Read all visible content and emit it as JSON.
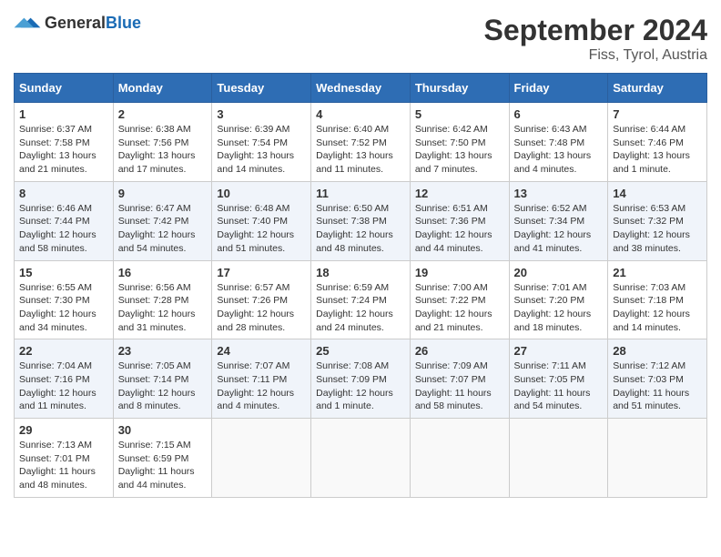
{
  "header": {
    "logo_general": "General",
    "logo_blue": "Blue",
    "month": "September 2024",
    "location": "Fiss, Tyrol, Austria"
  },
  "days_of_week": [
    "Sunday",
    "Monday",
    "Tuesday",
    "Wednesday",
    "Thursday",
    "Friday",
    "Saturday"
  ],
  "weeks": [
    [
      {
        "day": "1",
        "sunrise": "6:37 AM",
        "sunset": "7:58 PM",
        "daylight": "13 hours and 21 minutes."
      },
      {
        "day": "2",
        "sunrise": "6:38 AM",
        "sunset": "7:56 PM",
        "daylight": "13 hours and 17 minutes."
      },
      {
        "day": "3",
        "sunrise": "6:39 AM",
        "sunset": "7:54 PM",
        "daylight": "13 hours and 14 minutes."
      },
      {
        "day": "4",
        "sunrise": "6:40 AM",
        "sunset": "7:52 PM",
        "daylight": "13 hours and 11 minutes."
      },
      {
        "day": "5",
        "sunrise": "6:42 AM",
        "sunset": "7:50 PM",
        "daylight": "13 hours and 7 minutes."
      },
      {
        "day": "6",
        "sunrise": "6:43 AM",
        "sunset": "7:48 PM",
        "daylight": "13 hours and 4 minutes."
      },
      {
        "day": "7",
        "sunrise": "6:44 AM",
        "sunset": "7:46 PM",
        "daylight": "13 hours and 1 minute."
      }
    ],
    [
      {
        "day": "8",
        "sunrise": "6:46 AM",
        "sunset": "7:44 PM",
        "daylight": "12 hours and 58 minutes."
      },
      {
        "day": "9",
        "sunrise": "6:47 AM",
        "sunset": "7:42 PM",
        "daylight": "12 hours and 54 minutes."
      },
      {
        "day": "10",
        "sunrise": "6:48 AM",
        "sunset": "7:40 PM",
        "daylight": "12 hours and 51 minutes."
      },
      {
        "day": "11",
        "sunrise": "6:50 AM",
        "sunset": "7:38 PM",
        "daylight": "12 hours and 48 minutes."
      },
      {
        "day": "12",
        "sunrise": "6:51 AM",
        "sunset": "7:36 PM",
        "daylight": "12 hours and 44 minutes."
      },
      {
        "day": "13",
        "sunrise": "6:52 AM",
        "sunset": "7:34 PM",
        "daylight": "12 hours and 41 minutes."
      },
      {
        "day": "14",
        "sunrise": "6:53 AM",
        "sunset": "7:32 PM",
        "daylight": "12 hours and 38 minutes."
      }
    ],
    [
      {
        "day": "15",
        "sunrise": "6:55 AM",
        "sunset": "7:30 PM",
        "daylight": "12 hours and 34 minutes."
      },
      {
        "day": "16",
        "sunrise": "6:56 AM",
        "sunset": "7:28 PM",
        "daylight": "12 hours and 31 minutes."
      },
      {
        "day": "17",
        "sunrise": "6:57 AM",
        "sunset": "7:26 PM",
        "daylight": "12 hours and 28 minutes."
      },
      {
        "day": "18",
        "sunrise": "6:59 AM",
        "sunset": "7:24 PM",
        "daylight": "12 hours and 24 minutes."
      },
      {
        "day": "19",
        "sunrise": "7:00 AM",
        "sunset": "7:22 PM",
        "daylight": "12 hours and 21 minutes."
      },
      {
        "day": "20",
        "sunrise": "7:01 AM",
        "sunset": "7:20 PM",
        "daylight": "12 hours and 18 minutes."
      },
      {
        "day": "21",
        "sunrise": "7:03 AM",
        "sunset": "7:18 PM",
        "daylight": "12 hours and 14 minutes."
      }
    ],
    [
      {
        "day": "22",
        "sunrise": "7:04 AM",
        "sunset": "7:16 PM",
        "daylight": "12 hours and 11 minutes."
      },
      {
        "day": "23",
        "sunrise": "7:05 AM",
        "sunset": "7:14 PM",
        "daylight": "12 hours and 8 minutes."
      },
      {
        "day": "24",
        "sunrise": "7:07 AM",
        "sunset": "7:11 PM",
        "daylight": "12 hours and 4 minutes."
      },
      {
        "day": "25",
        "sunrise": "7:08 AM",
        "sunset": "7:09 PM",
        "daylight": "12 hours and 1 minute."
      },
      {
        "day": "26",
        "sunrise": "7:09 AM",
        "sunset": "7:07 PM",
        "daylight": "11 hours and 58 minutes."
      },
      {
        "day": "27",
        "sunrise": "7:11 AM",
        "sunset": "7:05 PM",
        "daylight": "11 hours and 54 minutes."
      },
      {
        "day": "28",
        "sunrise": "7:12 AM",
        "sunset": "7:03 PM",
        "daylight": "11 hours and 51 minutes."
      }
    ],
    [
      {
        "day": "29",
        "sunrise": "7:13 AM",
        "sunset": "7:01 PM",
        "daylight": "11 hours and 48 minutes."
      },
      {
        "day": "30",
        "sunrise": "7:15 AM",
        "sunset": "6:59 PM",
        "daylight": "11 hours and 44 minutes."
      },
      null,
      null,
      null,
      null,
      null
    ]
  ]
}
